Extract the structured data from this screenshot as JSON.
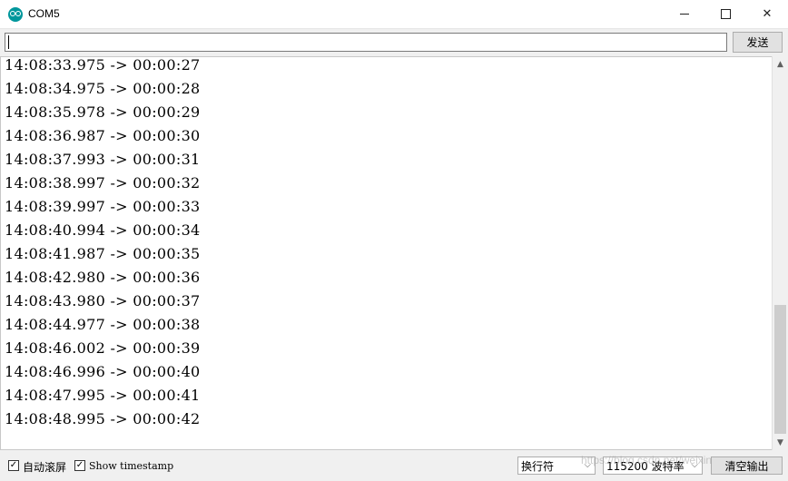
{
  "window": {
    "title": "COM5",
    "min_symbol": "—",
    "max_symbol": "☐",
    "close_symbol": "✕"
  },
  "send": {
    "input_value": "",
    "button_label": "发送"
  },
  "output": {
    "lines": [
      "14:08:33.975 -> 00:00:27",
      "14:08:34.975 -> 00:00:28",
      "14:08:35.978 -> 00:00:29",
      "14:08:36.987 -> 00:00:30",
      "14:08:37.993 -> 00:00:31",
      "14:08:38.997 -> 00:00:32",
      "14:08:39.997 -> 00:00:33",
      "14:08:40.994 -> 00:00:34",
      "14:08:41.987 -> 00:00:35",
      "14:08:42.980 -> 00:00:36",
      "14:08:43.980 -> 00:00:37",
      "14:08:44.977 -> 00:00:38",
      "14:08:46.002 -> 00:00:39",
      "14:08:46.996 -> 00:00:40",
      "14:08:47.995 -> 00:00:41",
      "14:08:48.995 -> 00:00:42"
    ]
  },
  "bottom": {
    "autoscroll_label": "自动滚屏",
    "autoscroll_checked": true,
    "timestamp_label": "Show timestamp",
    "timestamp_checked": true,
    "line_ending": "换行符",
    "baud_rate": "115200 波特率",
    "clear_label": "清空输出",
    "check_mark": "✓"
  },
  "scroll": {
    "up_arrow": "▲",
    "down_arrow": "▼"
  },
  "watermark": "https://blog.csdn.net/weixin"
}
